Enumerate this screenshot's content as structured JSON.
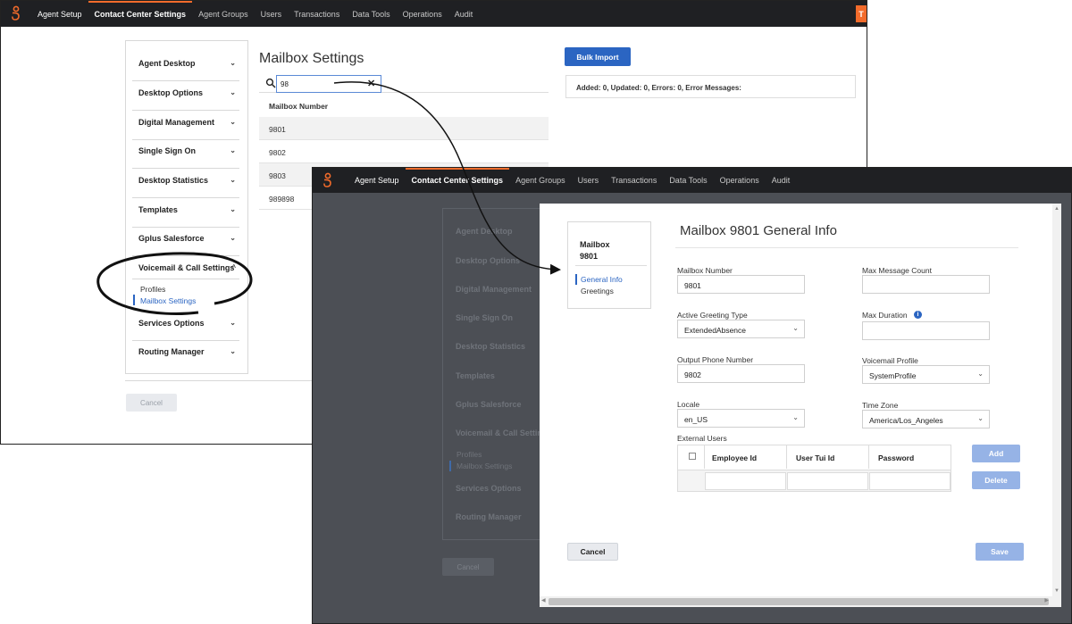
{
  "colors": {
    "nav_bg": "#1f2023",
    "accent_orange": "#f26b2b",
    "primary_blue": "#2b65c2",
    "disabled_blue": "#96b3e6",
    "overlay_gray": "#4c4f55"
  },
  "icons": {
    "logo": "genesys-logo-icon",
    "search": "search-icon",
    "clear": "close-icon",
    "chevron_down": "chevron-down-icon",
    "chevron_up": "chevron-up-icon",
    "info": "info-icon"
  },
  "nav": {
    "items": [
      "Agent Setup",
      "Contact Center Settings",
      "Agent Groups",
      "Users",
      "Transactions",
      "Data Tools",
      "Operations",
      "Audit"
    ],
    "active": "Contact Center Settings",
    "user_initial": "T"
  },
  "sidemenu": {
    "items": [
      {
        "label": "Agent Desktop",
        "chevron": "⌄"
      },
      {
        "label": "Desktop Options",
        "chevron": "⌄"
      },
      {
        "label": "Digital Management",
        "chevron": "⌄"
      },
      {
        "label": "Single Sign On",
        "chevron": "⌄"
      },
      {
        "label": "Desktop Statistics",
        "chevron": "⌄"
      },
      {
        "label": "Templates",
        "chevron": "⌄"
      },
      {
        "label": "Gplus Salesforce",
        "chevron": "⌄"
      },
      {
        "label": "Voicemail & Call Settings",
        "chevron": "^"
      },
      {
        "label": "Services Options",
        "chevron": "⌄"
      },
      {
        "label": "Routing Manager",
        "chevron": "⌄"
      }
    ],
    "sub_items": [
      "Profiles",
      "Mailbox Settings"
    ],
    "selected_sub": "Mailbox Settings",
    "cancel_label": "Cancel"
  },
  "mailbox_settings": {
    "title": "Mailbox Settings",
    "search_value": "98",
    "column_header": "Mailbox Number",
    "rows": [
      "9801",
      "9802",
      "9803",
      "989898"
    ],
    "bulk_import_label": "Bulk Import",
    "import_status": "Added: 0, Updated: 0, Errors: 0, Error Messages:"
  },
  "modal": {
    "mailbox_label": "Mailbox",
    "mailbox_number": "9801",
    "tabs": [
      "General Info",
      "Greetings"
    ],
    "active_tab": "General Info",
    "title": "Mailbox 9801 General Info",
    "fields": {
      "mailbox_number": {
        "label": "Mailbox Number",
        "value": "9801"
      },
      "max_message_count": {
        "label": "Max Message Count",
        "value": ""
      },
      "active_greeting_type": {
        "label": "Active Greeting Type",
        "value": "ExtendedAbsence"
      },
      "max_duration": {
        "label": "Max Duration",
        "value": ""
      },
      "output_phone_number": {
        "label": "Output Phone Number",
        "value": "9802"
      },
      "voicemail_profile": {
        "label": "Voicemail Profile",
        "value": "SystemProfile"
      },
      "locale": {
        "label": "Locale",
        "value": "en_US"
      },
      "time_zone": {
        "label": "Time Zone",
        "value": "America/Los_Angeles"
      }
    },
    "external_users": {
      "label": "External Users",
      "columns": [
        "Employee Id",
        "User Tui Id",
        "Password"
      ]
    },
    "add_label": "Add",
    "delete_label": "Delete",
    "cancel_label": "Cancel",
    "save_label": "Save"
  }
}
